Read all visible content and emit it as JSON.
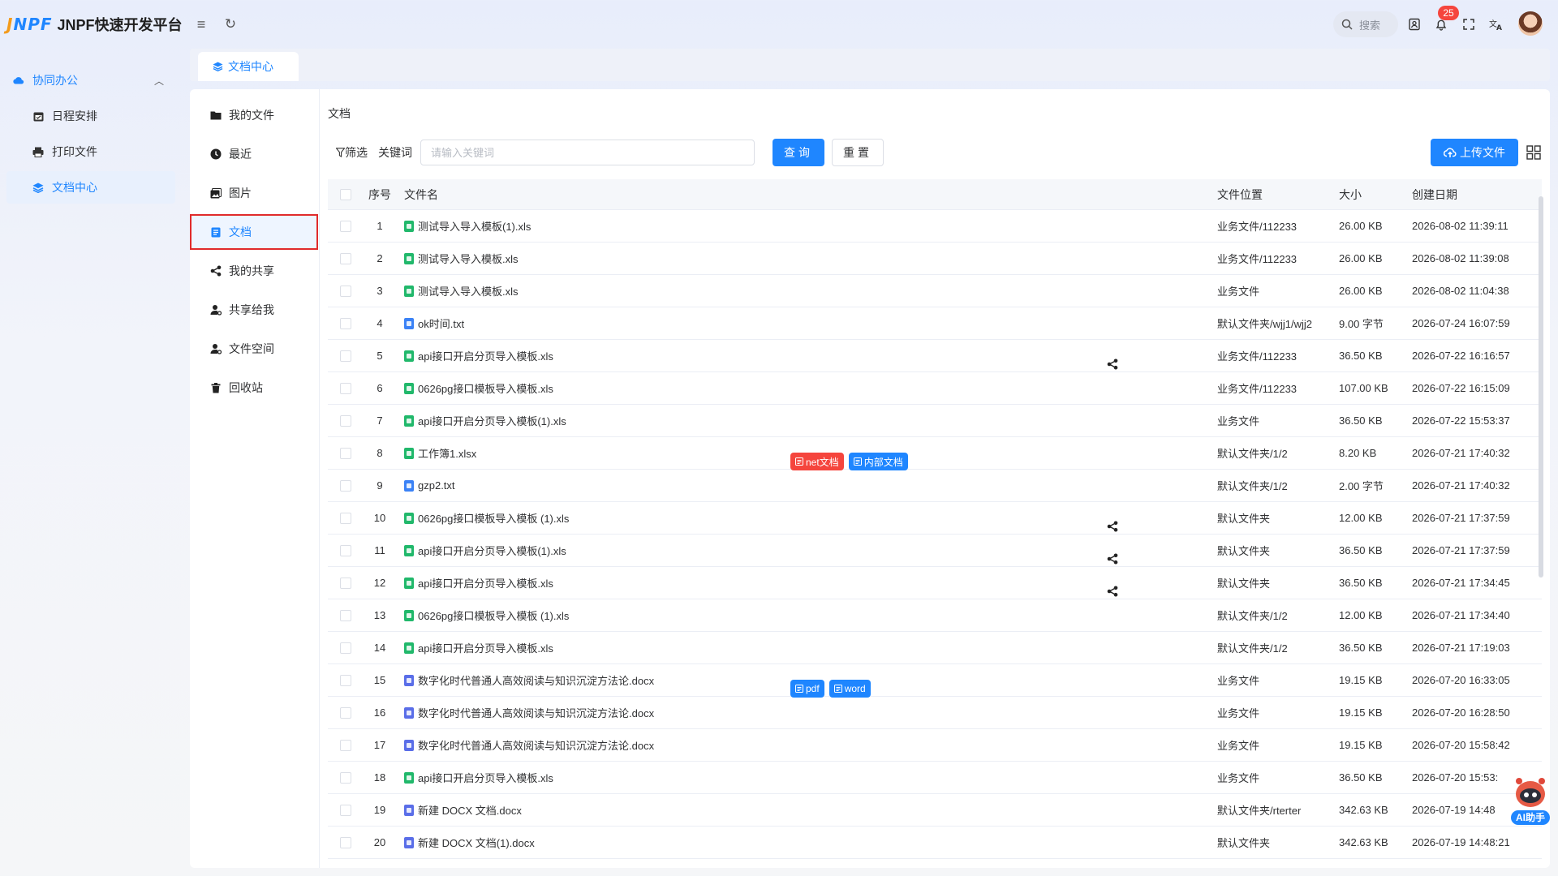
{
  "app": {
    "logo_mark": "JNPF",
    "title": "JNPF快速开发平台"
  },
  "topbar": {
    "search_label": "搜索",
    "notification_count": "25"
  },
  "sidebar": {
    "group_label": "协同办公",
    "items": [
      {
        "label": "日程安排",
        "icon": "calendar-icon"
      },
      {
        "label": "打印文件",
        "icon": "printer-icon"
      },
      {
        "label": "文档中心",
        "icon": "layers-icon",
        "active": true
      }
    ],
    "collapse_glyph": "«"
  },
  "tabs": [
    {
      "label": "文档中心"
    }
  ],
  "left_nav": [
    {
      "label": "我的文件",
      "icon": "folder-icon"
    },
    {
      "label": "最近",
      "icon": "clock-icon"
    },
    {
      "label": "图片",
      "icon": "image-icon"
    },
    {
      "label": "文档",
      "icon": "document-icon",
      "active": true
    },
    {
      "label": "我的共享",
      "icon": "share-icon"
    },
    {
      "label": "共享给我",
      "icon": "user-share-icon"
    },
    {
      "label": "文件空间",
      "icon": "user-space-icon"
    },
    {
      "label": "回收站",
      "icon": "trash-icon"
    }
  ],
  "main": {
    "title": "文档",
    "filter_label": "筛选",
    "keyword_label": "关键词",
    "keyword_placeholder": "请输入关键词",
    "query_button": "查询",
    "reset_button": "重置",
    "upload_button": "上传文件"
  },
  "table": {
    "columns": {
      "no": "序号",
      "name": "文件名",
      "location": "文件位置",
      "size": "大小",
      "date": "创建日期"
    },
    "rows": [
      {
        "no": "1",
        "name": "测试导入导入模板(1).xls",
        "type": "xls",
        "location": "业务文件/112233",
        "size": "26.00 KB",
        "date": "2026-08-02 11:39:11"
      },
      {
        "no": "2",
        "name": "测试导入导入模板.xls",
        "type": "xls",
        "location": "业务文件/112233",
        "size": "26.00 KB",
        "date": "2026-08-02 11:39:08"
      },
      {
        "no": "3",
        "name": "测试导入导入模板.xls",
        "type": "xls",
        "location": "业务文件",
        "size": "26.00 KB",
        "date": "2026-08-02 11:04:38"
      },
      {
        "no": "4",
        "name": "ok时间.txt",
        "type": "txt",
        "location": "默认文件夹/wjj1/wjj2",
        "size": "9.00 字节",
        "date": "2026-07-24 16:07:59"
      },
      {
        "no": "5",
        "name": "api接口开启分页导入模板.xls",
        "type": "xls",
        "location": "业务文件/112233",
        "size": "36.50 KB",
        "date": "2026-07-22 16:16:57",
        "shared": true
      },
      {
        "no": "6",
        "name": "0626pg接口模板导入模板.xls",
        "type": "xls",
        "location": "业务文件/112233",
        "size": "107.00 KB",
        "date": "2026-07-22 16:15:09"
      },
      {
        "no": "7",
        "name": "api接口开启分页导入模板(1).xls",
        "type": "xls",
        "location": "业务文件",
        "size": "36.50 KB",
        "date": "2026-07-22 15:53:37"
      },
      {
        "no": "8",
        "name": "工作簿1.xlsx",
        "type": "xls",
        "location": "默认文件夹/1/2",
        "size": "8.20 KB",
        "date": "2026-07-21 17:40:32",
        "tags": [
          {
            "label": "net文档",
            "color": "#f5453d"
          },
          {
            "label": "内部文档",
            "color": "#1f86ff"
          }
        ]
      },
      {
        "no": "9",
        "name": "gzp2.txt",
        "type": "txt",
        "location": "默认文件夹/1/2",
        "size": "2.00 字节",
        "date": "2026-07-21 17:40:32"
      },
      {
        "no": "10",
        "name": "0626pg接口模板导入模板 (1).xls",
        "type": "xls",
        "location": "默认文件夹",
        "size": "12.00 KB",
        "date": "2026-07-21 17:37:59",
        "shared": true
      },
      {
        "no": "11",
        "name": "api接口开启分页导入模板(1).xls",
        "type": "xls",
        "location": "默认文件夹",
        "size": "36.50 KB",
        "date": "2026-07-21 17:37:59",
        "shared": true
      },
      {
        "no": "12",
        "name": "api接口开启分页导入模板.xls",
        "type": "xls",
        "location": "默认文件夹",
        "size": "36.50 KB",
        "date": "2026-07-21 17:34:45",
        "shared": true
      },
      {
        "no": "13",
        "name": "0626pg接口模板导入模板 (1).xls",
        "type": "xls",
        "location": "默认文件夹/1/2",
        "size": "12.00 KB",
        "date": "2026-07-21 17:34:40"
      },
      {
        "no": "14",
        "name": "api接口开启分页导入模板.xls",
        "type": "xls",
        "location": "默认文件夹/1/2",
        "size": "36.50 KB",
        "date": "2026-07-21 17:19:03"
      },
      {
        "no": "15",
        "name": "数字化时代普通人高效阅读与知识沉淀方法论.docx",
        "type": "doc",
        "location": "业务文件",
        "size": "19.15 KB",
        "date": "2026-07-20 16:33:05",
        "tags": [
          {
            "label": "pdf",
            "color": "#1f86ff"
          },
          {
            "label": "word",
            "color": "#1f86ff"
          }
        ]
      },
      {
        "no": "16",
        "name": "数字化时代普通人高效阅读与知识沉淀方法论.docx",
        "type": "doc",
        "location": "业务文件",
        "size": "19.15 KB",
        "date": "2026-07-20 16:28:50"
      },
      {
        "no": "17",
        "name": "数字化时代普通人高效阅读与知识沉淀方法论.docx",
        "type": "doc",
        "location": "业务文件",
        "size": "19.15 KB",
        "date": "2026-07-20 15:58:42"
      },
      {
        "no": "18",
        "name": "api接口开启分页导入模板.xls",
        "type": "xls",
        "location": "业务文件",
        "size": "36.50 KB",
        "date": "2026-07-20 15:53:"
      },
      {
        "no": "19",
        "name": "新建 DOCX 文档.docx",
        "type": "doc",
        "location": "默认文件夹/rterter",
        "size": "342.63 KB",
        "date": "2026-07-19 14:48"
      },
      {
        "no": "20",
        "name": "新建 DOCX 文档(1).docx",
        "type": "doc",
        "location": "默认文件夹",
        "size": "342.63 KB",
        "date": "2026-07-19 14:48:21"
      }
    ]
  },
  "assistant": {
    "label": "AI助手"
  },
  "colors": {
    "primary": "#1f86ff",
    "danger": "#f5453d",
    "excel": "#21b86b",
    "word": "#5a6ee8"
  }
}
